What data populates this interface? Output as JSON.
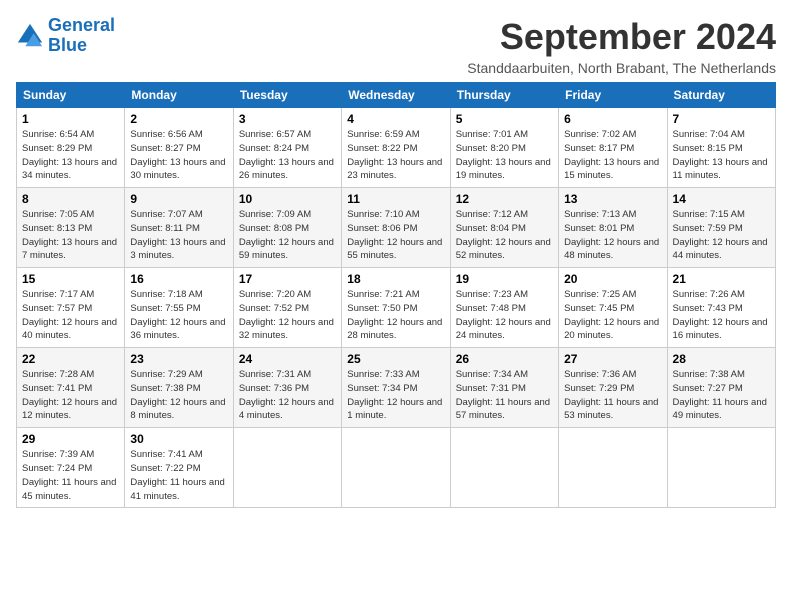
{
  "header": {
    "logo_line1": "General",
    "logo_line2": "Blue",
    "month": "September 2024",
    "location": "Standdaarbuiten, North Brabant, The Netherlands"
  },
  "days_of_week": [
    "Sunday",
    "Monday",
    "Tuesday",
    "Wednesday",
    "Thursday",
    "Friday",
    "Saturday"
  ],
  "weeks": [
    [
      {
        "day": "1",
        "sunrise": "Sunrise: 6:54 AM",
        "sunset": "Sunset: 8:29 PM",
        "daylight": "Daylight: 13 hours and 34 minutes."
      },
      {
        "day": "2",
        "sunrise": "Sunrise: 6:56 AM",
        "sunset": "Sunset: 8:27 PM",
        "daylight": "Daylight: 13 hours and 30 minutes."
      },
      {
        "day": "3",
        "sunrise": "Sunrise: 6:57 AM",
        "sunset": "Sunset: 8:24 PM",
        "daylight": "Daylight: 13 hours and 26 minutes."
      },
      {
        "day": "4",
        "sunrise": "Sunrise: 6:59 AM",
        "sunset": "Sunset: 8:22 PM",
        "daylight": "Daylight: 13 hours and 23 minutes."
      },
      {
        "day": "5",
        "sunrise": "Sunrise: 7:01 AM",
        "sunset": "Sunset: 8:20 PM",
        "daylight": "Daylight: 13 hours and 19 minutes."
      },
      {
        "day": "6",
        "sunrise": "Sunrise: 7:02 AM",
        "sunset": "Sunset: 8:17 PM",
        "daylight": "Daylight: 13 hours and 15 minutes."
      },
      {
        "day": "7",
        "sunrise": "Sunrise: 7:04 AM",
        "sunset": "Sunset: 8:15 PM",
        "daylight": "Daylight: 13 hours and 11 minutes."
      }
    ],
    [
      {
        "day": "8",
        "sunrise": "Sunrise: 7:05 AM",
        "sunset": "Sunset: 8:13 PM",
        "daylight": "Daylight: 13 hours and 7 minutes."
      },
      {
        "day": "9",
        "sunrise": "Sunrise: 7:07 AM",
        "sunset": "Sunset: 8:11 PM",
        "daylight": "Daylight: 13 hours and 3 minutes."
      },
      {
        "day": "10",
        "sunrise": "Sunrise: 7:09 AM",
        "sunset": "Sunset: 8:08 PM",
        "daylight": "Daylight: 12 hours and 59 minutes."
      },
      {
        "day": "11",
        "sunrise": "Sunrise: 7:10 AM",
        "sunset": "Sunset: 8:06 PM",
        "daylight": "Daylight: 12 hours and 55 minutes."
      },
      {
        "day": "12",
        "sunrise": "Sunrise: 7:12 AM",
        "sunset": "Sunset: 8:04 PM",
        "daylight": "Daylight: 12 hours and 52 minutes."
      },
      {
        "day": "13",
        "sunrise": "Sunrise: 7:13 AM",
        "sunset": "Sunset: 8:01 PM",
        "daylight": "Daylight: 12 hours and 48 minutes."
      },
      {
        "day": "14",
        "sunrise": "Sunrise: 7:15 AM",
        "sunset": "Sunset: 7:59 PM",
        "daylight": "Daylight: 12 hours and 44 minutes."
      }
    ],
    [
      {
        "day": "15",
        "sunrise": "Sunrise: 7:17 AM",
        "sunset": "Sunset: 7:57 PM",
        "daylight": "Daylight: 12 hours and 40 minutes."
      },
      {
        "day": "16",
        "sunrise": "Sunrise: 7:18 AM",
        "sunset": "Sunset: 7:55 PM",
        "daylight": "Daylight: 12 hours and 36 minutes."
      },
      {
        "day": "17",
        "sunrise": "Sunrise: 7:20 AM",
        "sunset": "Sunset: 7:52 PM",
        "daylight": "Daylight: 12 hours and 32 minutes."
      },
      {
        "day": "18",
        "sunrise": "Sunrise: 7:21 AM",
        "sunset": "Sunset: 7:50 PM",
        "daylight": "Daylight: 12 hours and 28 minutes."
      },
      {
        "day": "19",
        "sunrise": "Sunrise: 7:23 AM",
        "sunset": "Sunset: 7:48 PM",
        "daylight": "Daylight: 12 hours and 24 minutes."
      },
      {
        "day": "20",
        "sunrise": "Sunrise: 7:25 AM",
        "sunset": "Sunset: 7:45 PM",
        "daylight": "Daylight: 12 hours and 20 minutes."
      },
      {
        "day": "21",
        "sunrise": "Sunrise: 7:26 AM",
        "sunset": "Sunset: 7:43 PM",
        "daylight": "Daylight: 12 hours and 16 minutes."
      }
    ],
    [
      {
        "day": "22",
        "sunrise": "Sunrise: 7:28 AM",
        "sunset": "Sunset: 7:41 PM",
        "daylight": "Daylight: 12 hours and 12 minutes."
      },
      {
        "day": "23",
        "sunrise": "Sunrise: 7:29 AM",
        "sunset": "Sunset: 7:38 PM",
        "daylight": "Daylight: 12 hours and 8 minutes."
      },
      {
        "day": "24",
        "sunrise": "Sunrise: 7:31 AM",
        "sunset": "Sunset: 7:36 PM",
        "daylight": "Daylight: 12 hours and 4 minutes."
      },
      {
        "day": "25",
        "sunrise": "Sunrise: 7:33 AM",
        "sunset": "Sunset: 7:34 PM",
        "daylight": "Daylight: 12 hours and 1 minute."
      },
      {
        "day": "26",
        "sunrise": "Sunrise: 7:34 AM",
        "sunset": "Sunset: 7:31 PM",
        "daylight": "Daylight: 11 hours and 57 minutes."
      },
      {
        "day": "27",
        "sunrise": "Sunrise: 7:36 AM",
        "sunset": "Sunset: 7:29 PM",
        "daylight": "Daylight: 11 hours and 53 minutes."
      },
      {
        "day": "28",
        "sunrise": "Sunrise: 7:38 AM",
        "sunset": "Sunset: 7:27 PM",
        "daylight": "Daylight: 11 hours and 49 minutes."
      }
    ],
    [
      {
        "day": "29",
        "sunrise": "Sunrise: 7:39 AM",
        "sunset": "Sunset: 7:24 PM",
        "daylight": "Daylight: 11 hours and 45 minutes."
      },
      {
        "day": "30",
        "sunrise": "Sunrise: 7:41 AM",
        "sunset": "Sunset: 7:22 PM",
        "daylight": "Daylight: 11 hours and 41 minutes."
      },
      null,
      null,
      null,
      null,
      null
    ]
  ]
}
